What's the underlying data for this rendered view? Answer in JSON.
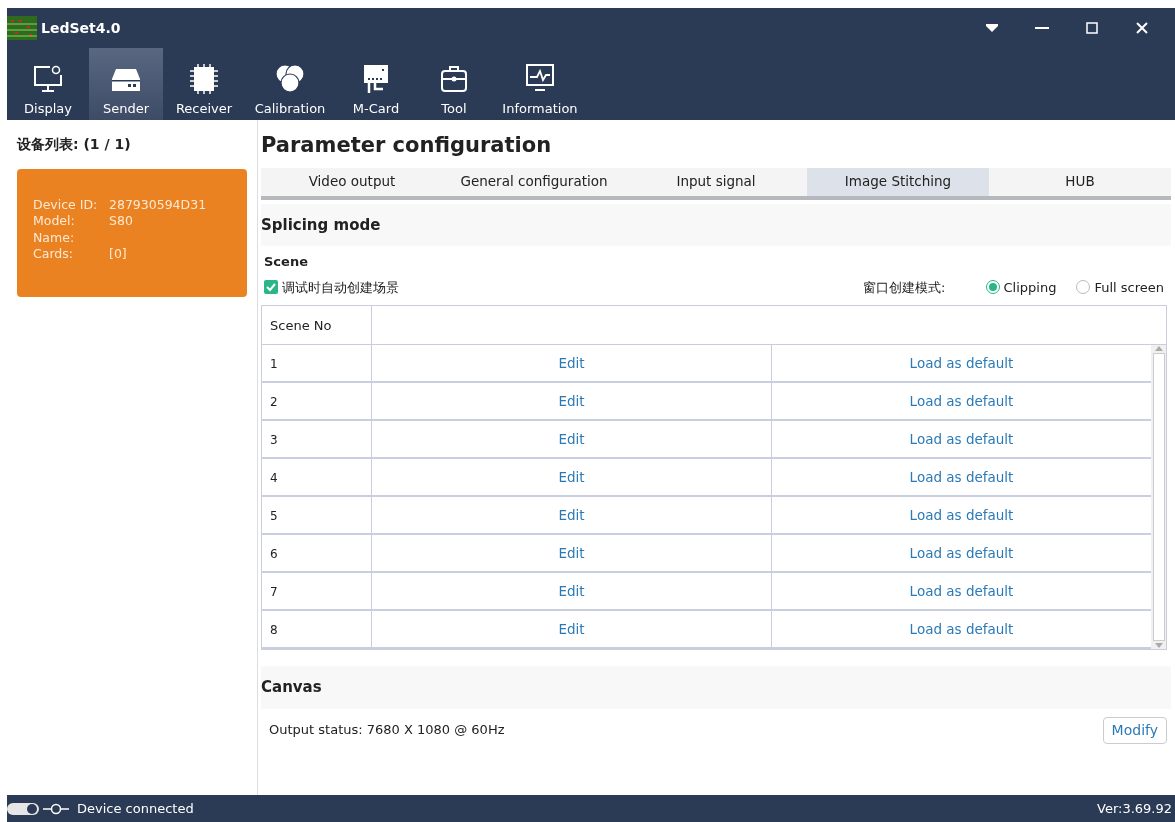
{
  "window": {
    "title": "LedSet4.0"
  },
  "toolbar": [
    {
      "label": "Display",
      "selected": false
    },
    {
      "label": "Sender",
      "selected": true
    },
    {
      "label": "Receiver",
      "selected": false
    },
    {
      "label": "Calibration",
      "selected": false
    },
    {
      "label": "M-Card",
      "selected": false
    },
    {
      "label": "Tool",
      "selected": false
    },
    {
      "label": "Information",
      "selected": false
    }
  ],
  "device_list": {
    "title": "设备列表: (1 / 1)",
    "devices": [
      {
        "fields": [
          {
            "label": "Device ID:",
            "value": "287930594D31"
          },
          {
            "label": "Model:",
            "value": "S80"
          },
          {
            "label": "Name:"
          },
          {
            "label": "Cards:",
            "value": "[0]"
          }
        ]
      }
    ]
  },
  "page_title": "Parameter configuration",
  "tabs": [
    {
      "label": "Video output",
      "selected": false
    },
    {
      "label": "General configuration",
      "selected": false
    },
    {
      "label": "Input signal",
      "selected": false
    },
    {
      "label": "Image Stitching",
      "selected": true
    },
    {
      "label": "HUB",
      "selected": false
    }
  ],
  "splicing": {
    "title": "Splicing mode",
    "scene_title": "Scene",
    "auto_create": {
      "label": "调试时自动创建场景",
      "checked": true
    },
    "window_mode": {
      "label": "窗口创建模式:",
      "options": [
        {
          "label": "Clipping",
          "selected": true
        },
        {
          "label": "Full screen",
          "selected": false
        }
      ]
    },
    "table": {
      "columns": [
        "Scene No"
      ],
      "rows": [
        {
          "number": "1",
          "edit": "Edit",
          "load": "Load as default"
        },
        {
          "number": "2",
          "edit": "Edit",
          "load": "Load as default"
        },
        {
          "number": "3",
          "edit": "Edit",
          "load": "Load as default"
        },
        {
          "number": "4",
          "edit": "Edit",
          "load": "Load as default"
        },
        {
          "number": "5",
          "edit": "Edit",
          "load": "Load as default"
        },
        {
          "number": "6",
          "edit": "Edit",
          "load": "Load as default"
        },
        {
          "number": "7",
          "edit": "Edit",
          "load": "Load as default"
        },
        {
          "number": "8",
          "edit": "Edit",
          "load": "Load as default"
        }
      ]
    }
  },
  "canvas": {
    "title": "Canvas",
    "output_status": "Output status: 7680 X 1080 @ 60Hz",
    "modify_button": "Modify"
  },
  "status_bar": {
    "connection": "Device connected",
    "version": "Ver:3.69.92"
  }
}
